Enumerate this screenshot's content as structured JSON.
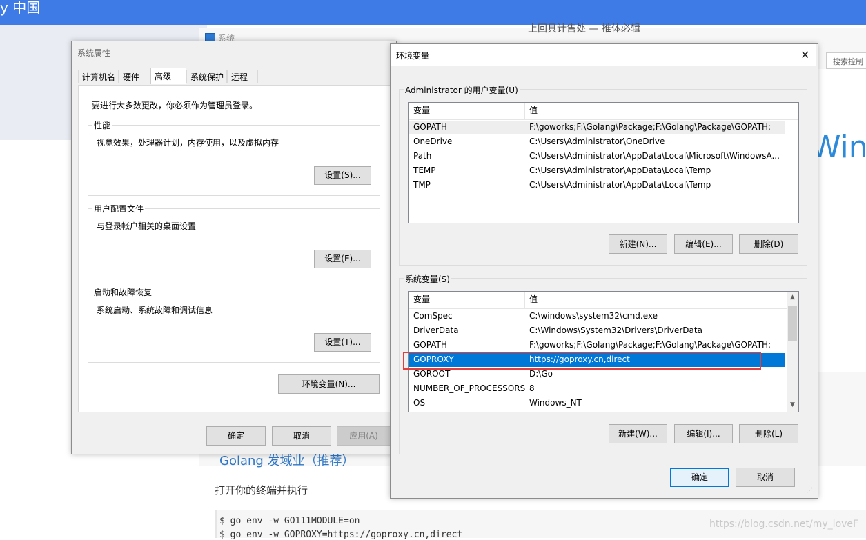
{
  "background_page": {
    "top_bar_text": "y 中国",
    "top_partial_text": "上回具计售处 — 推体必辑",
    "section_heading_partial": "Golang 发域业（推荐）",
    "paragraph": "打开你的终端并执行",
    "code_lines": [
      "$ go env -w GO111MODULE=on",
      "$ go env -w GOPROXY=https://goproxy.cn,direct"
    ],
    "watermark": "https://blog.csdn.net/my_loveF"
  },
  "system_window": {
    "title": "系统",
    "search_placeholder": "搜索控制",
    "heading_partial": "Winc"
  },
  "system_properties": {
    "title": "系统属性",
    "tabs": [
      "计算机名",
      "硬件",
      "高级",
      "系统保护",
      "远程"
    ],
    "active_tab": "高级",
    "admin_note": "要进行大多数更改，你必须作为管理员登录。",
    "performance": {
      "label": "性能",
      "description": "视觉效果，处理器计划，内存使用，以及虚拟内存",
      "button": "设置(S)..."
    },
    "user_profiles": {
      "label": "用户配置文件",
      "description": "与登录帐户相关的桌面设置",
      "button": "设置(E)..."
    },
    "startup_recovery": {
      "label": "启动和故障恢复",
      "description": "系统启动、系统故障和调试信息",
      "button": "设置(T)..."
    },
    "env_button": "环境变量(N)...",
    "ok": "确定",
    "cancel": "取消",
    "apply": "应用(A)"
  },
  "env_vars": {
    "title": "环境变量",
    "close": "✕",
    "user_section": "Administrator 的用户变量(U)",
    "col_var": "变量",
    "col_val": "值",
    "user_rows": [
      {
        "name": "GOPATH",
        "value": "F:\\goworks;F:\\Golang\\Package;F:\\Golang\\Package\\GOPATH;"
      },
      {
        "name": "OneDrive",
        "value": "C:\\Users\\Administrator\\OneDrive"
      },
      {
        "name": "Path",
        "value": "C:\\Users\\Administrator\\AppData\\Local\\Microsoft\\WindowsA..."
      },
      {
        "name": "TEMP",
        "value": "C:\\Users\\Administrator\\AppData\\Local\\Temp"
      },
      {
        "name": "TMP",
        "value": "C:\\Users\\Administrator\\AppData\\Local\\Temp"
      }
    ],
    "user_buttons": {
      "new": "新建(N)...",
      "edit": "编辑(E)...",
      "delete": "删除(D)"
    },
    "system_section": "系统变量(S)",
    "system_rows": [
      {
        "name": "ComSpec",
        "value": "C:\\windows\\system32\\cmd.exe"
      },
      {
        "name": "DriverData",
        "value": "C:\\Windows\\System32\\Drivers\\DriverData"
      },
      {
        "name": "GOPATH",
        "value": "F:\\goworks;F:\\Golang\\Package;F:\\Golang\\Package\\GOPATH;"
      },
      {
        "name": "GOPROXY",
        "value": "https://goproxy.cn,direct"
      },
      {
        "name": "GOROOT",
        "value": "D:\\Go"
      },
      {
        "name": "NUMBER_OF_PROCESSORS",
        "value": "8"
      },
      {
        "name": "OS",
        "value": "Windows_NT"
      }
    ],
    "selected_system_row": "GOPROXY",
    "system_buttons": {
      "new": "新建(W)...",
      "edit": "编辑(I)...",
      "delete": "删除(L)"
    },
    "ok": "确定",
    "cancel": "取消"
  },
  "colors": {
    "selection": "#0078d7",
    "highlight_box": "#e33e3e",
    "top_bar": "#3e7be7"
  }
}
